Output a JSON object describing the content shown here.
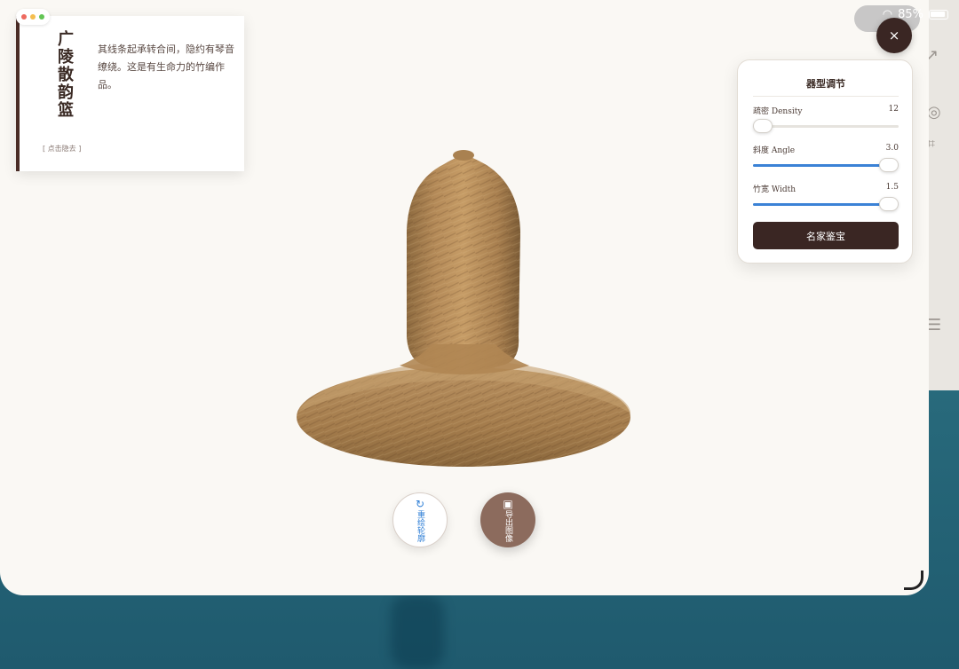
{
  "status": {
    "battery": "85%"
  },
  "card": {
    "title": "广陵散韵篮",
    "description": "其线条起承转合间，隐约有琴音缭绕。这是有生命力的竹编作品。",
    "hide_label": "[ 点击隐去 ]"
  },
  "close_label": "×",
  "panel": {
    "title": "器型调节",
    "sliders": [
      {
        "label": "疏密 Density",
        "value": "12",
        "fraction": 0.03
      },
      {
        "label": "斜度 Angle",
        "value": "3.0",
        "fraction": 0.93
      },
      {
        "label": "竹宽 Width",
        "value": "1.5",
        "fraction": 0.93
      }
    ],
    "button_label": "名家鉴宝"
  },
  "actions": {
    "redraw_label": "重绘轮廓",
    "export_label": "导出图像"
  },
  "colors": {
    "accent_dark": "#3a2623",
    "slider_fill": "#3b82d6",
    "vessel": "#b48a58"
  },
  "icons": {
    "redraw": "refresh-icon",
    "export": "floppy-disk-icon"
  }
}
